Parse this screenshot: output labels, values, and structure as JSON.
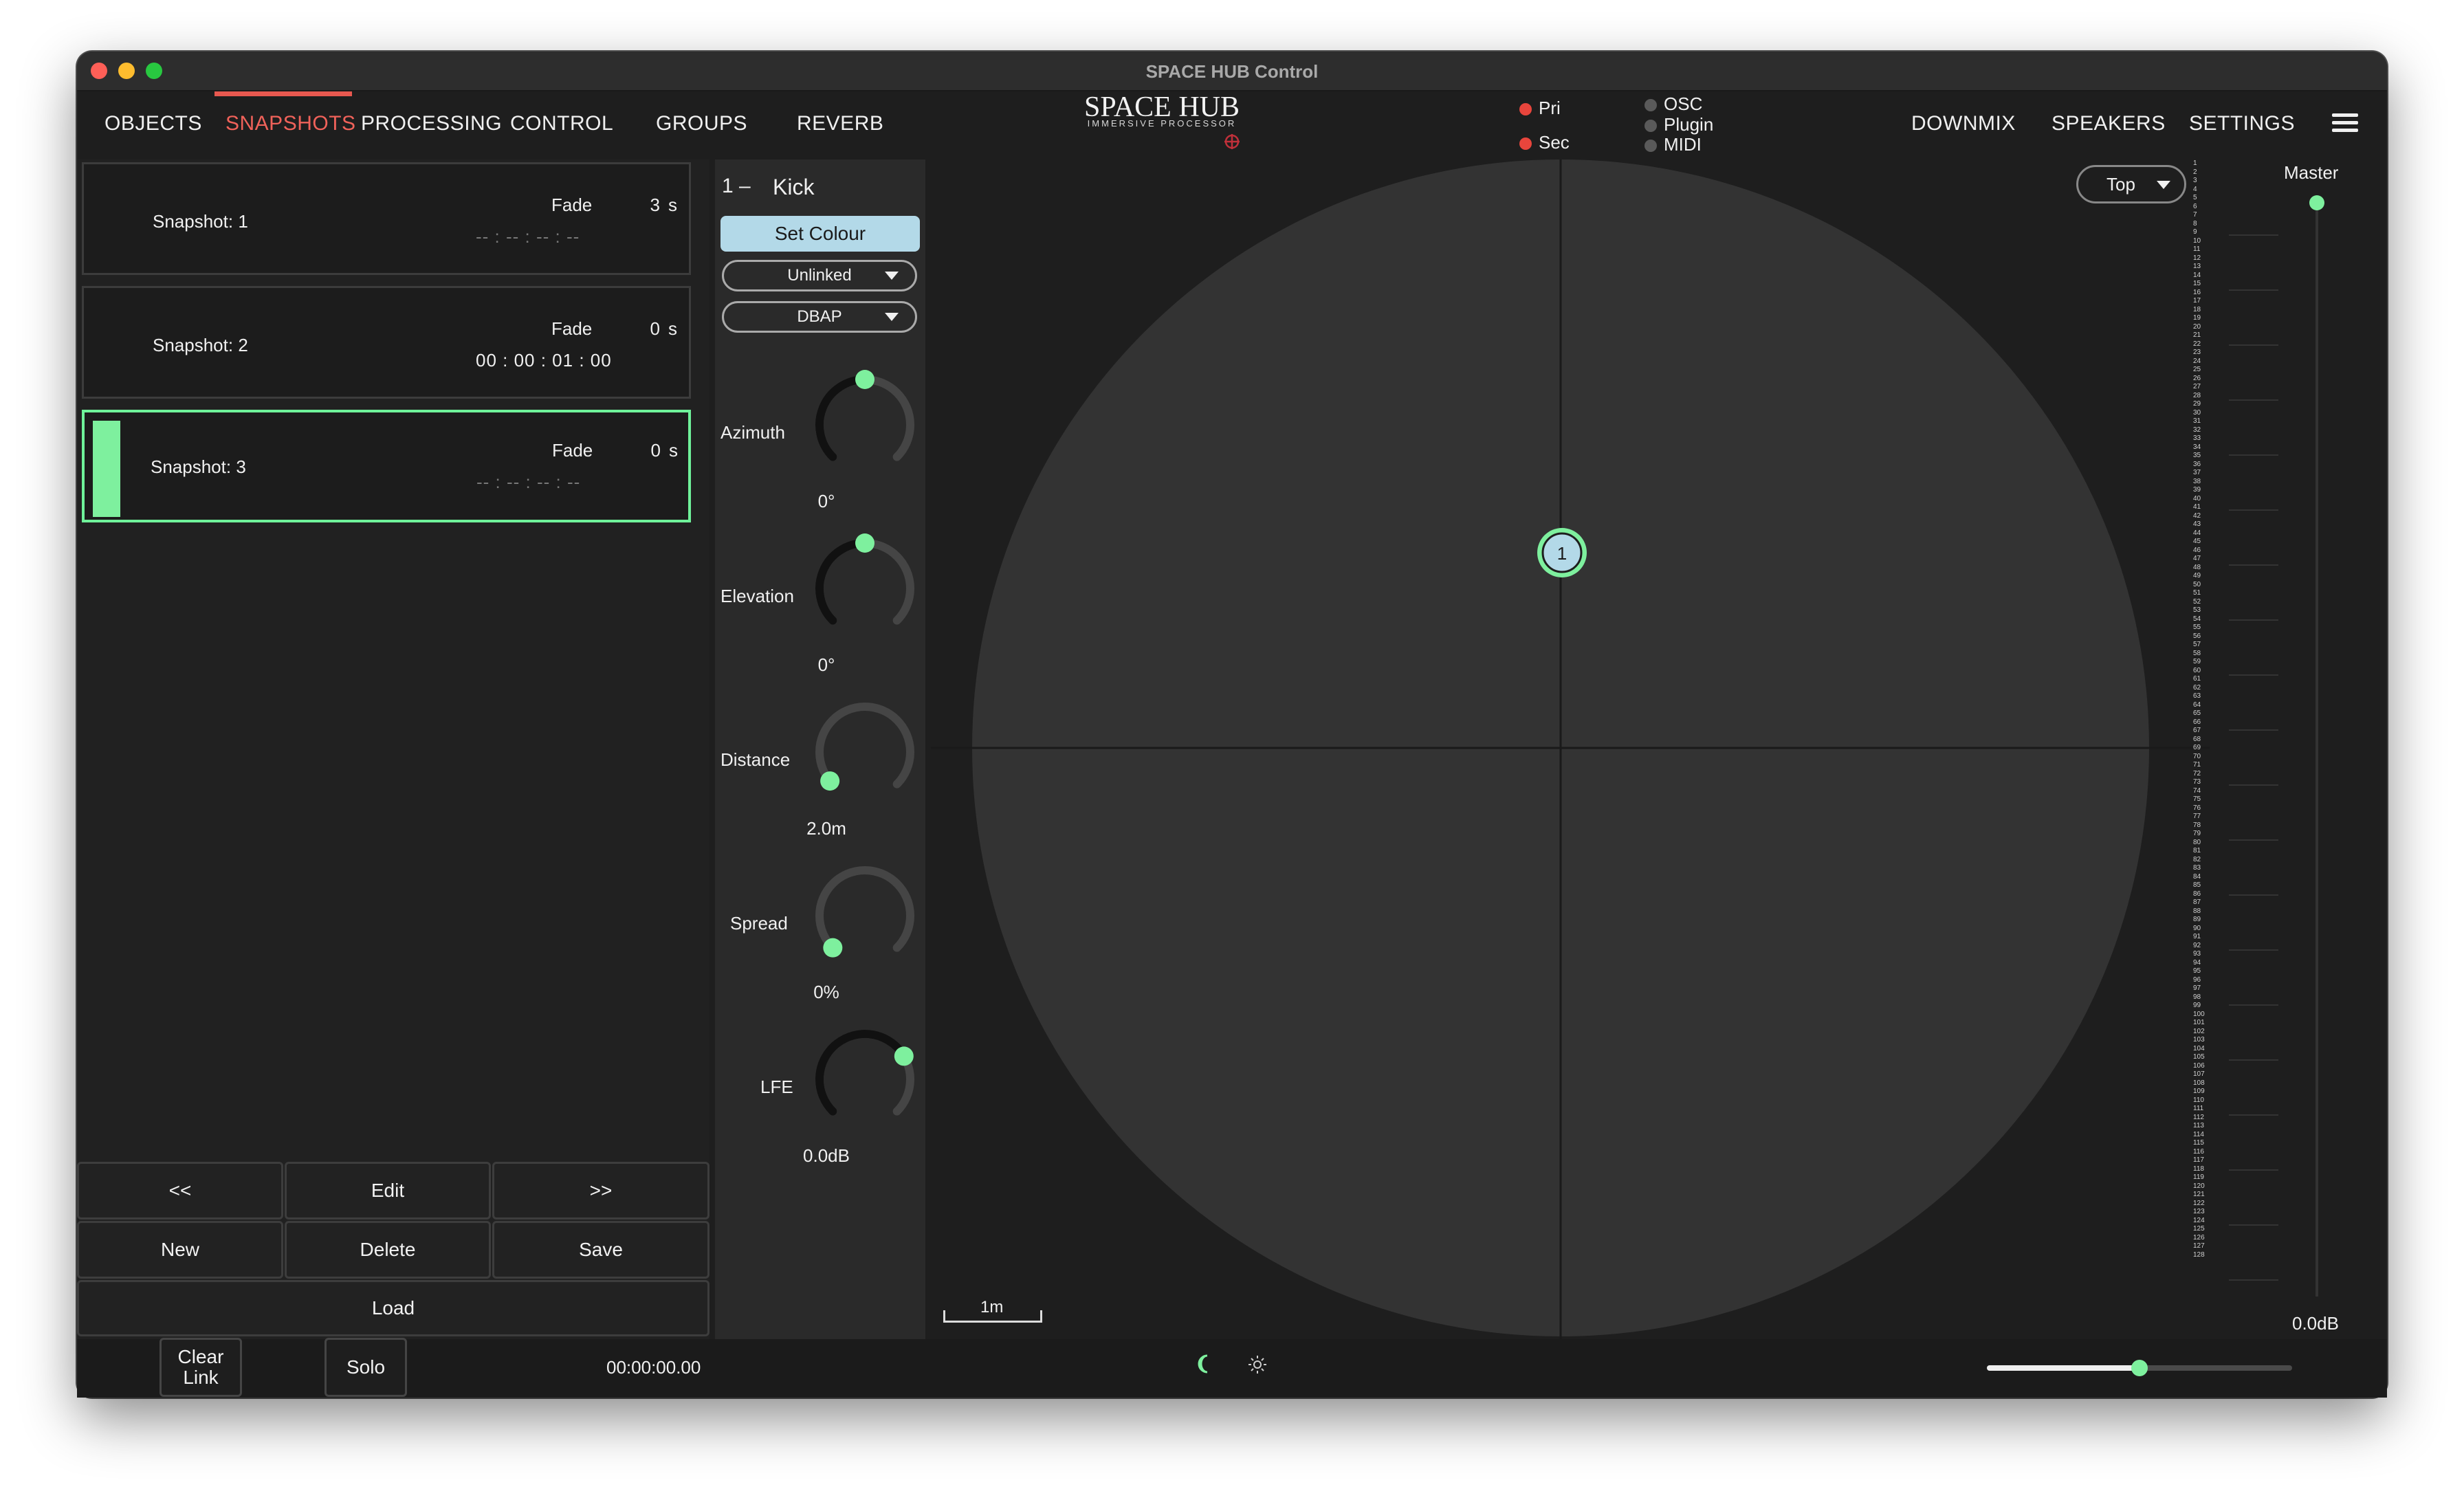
{
  "window": {
    "title": "SPACE HUB Control"
  },
  "nav": {
    "left_tabs": [
      "OBJECTS",
      "SNAPSHOTS",
      "PROCESSING",
      "CONTROL",
      "GROUPS",
      "REVERB"
    ],
    "active_tab": "SNAPSHOTS",
    "right_tabs": [
      "DOWNMIX",
      "SPEAKERS",
      "SETTINGS"
    ]
  },
  "logo": {
    "title": "SPACE HUB",
    "subtitle": "IMMERSIVE PROCESSOR"
  },
  "sync": {
    "pri": "Pri",
    "sec": "Sec",
    "osc": "OSC",
    "plugin": "Plugin",
    "midi": "MIDI",
    "active_color": "#e8453c",
    "inactive_color": "#5a5a5a"
  },
  "snapshots": [
    {
      "name": "Snapshot: 1",
      "fade_label": "Fade",
      "fade": "3",
      "unit": "s",
      "time": "-- : -- : -- : --",
      "selected": false
    },
    {
      "name": "Snapshot: 2",
      "fade_label": "Fade",
      "fade": "0",
      "unit": "s",
      "time": "00 : 00 : 01 : 00",
      "selected": false
    },
    {
      "name": "Snapshot: 3",
      "fade_label": "Fade",
      "fade": "0",
      "unit": "s",
      "time": "-- : -- : -- : --",
      "selected": true
    }
  ],
  "snapshot_buttons": {
    "prev": "<<",
    "edit": "Edit",
    "next": ">>",
    "new": "New",
    "delete": "Delete",
    "save": "Save",
    "load": "Load"
  },
  "object": {
    "number": "1 –",
    "name": "Kick",
    "set_colour": "Set Colour",
    "link_mode": "Unlinked",
    "algorithm": "DBAP",
    "colour": "#b3d9e8"
  },
  "knobs": {
    "azimuth": {
      "label": "Azimuth",
      "value": "0°",
      "position": 0.5
    },
    "elevation": {
      "label": "Elevation",
      "value": "0°",
      "position": 0.5
    },
    "distance": {
      "label": "Distance",
      "value": "2.0m",
      "position": 0.02
    },
    "spread": {
      "label": "Spread",
      "value": "0%",
      "position": 0.0
    },
    "lfe": {
      "label": "LFE",
      "value": "0.0dB",
      "position": 0.72
    }
  },
  "viewport": {
    "view_mode": "Top",
    "scale_label": "1m",
    "object_marker": "1"
  },
  "channels": {
    "first": 1,
    "last": 128
  },
  "master": {
    "label": "Master",
    "value": "0.0dB",
    "level": 1.0
  },
  "bottom": {
    "clear_link": "Clear\nLink",
    "clear_line1": "Clear",
    "clear_line2": "Link",
    "solo": "Solo",
    "timecode": "00:00:00.00",
    "slider_level": 0.5
  },
  "accent_color": "#7ef09e",
  "tab_accent_color": "#f0625a"
}
